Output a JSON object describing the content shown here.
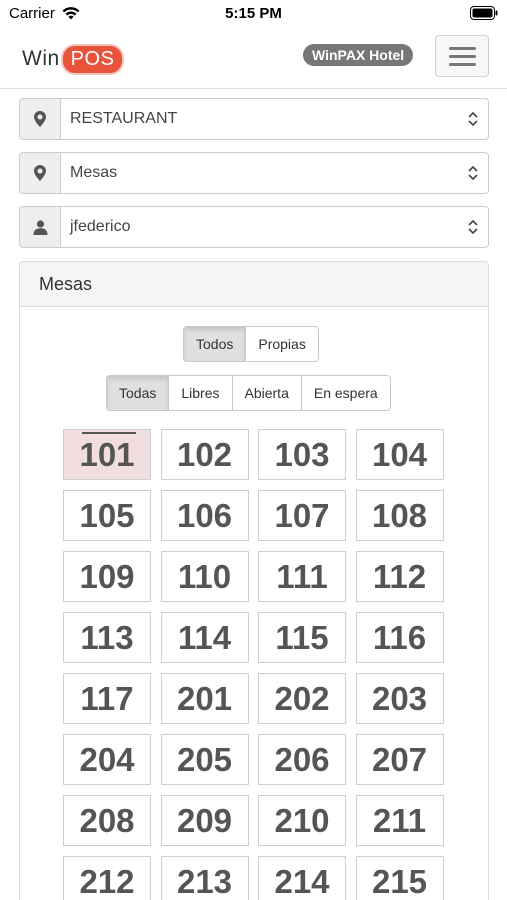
{
  "status_bar": {
    "carrier": "Carrier",
    "time": "5:15 PM"
  },
  "header": {
    "logo_win": "Win",
    "logo_pos": "POS",
    "hotel": "WinPAX Hotel"
  },
  "selects": {
    "location": "RESTAURANT",
    "area": "Mesas",
    "user": "jfederico"
  },
  "panel": {
    "title": "Mesas",
    "owner_filter": [
      "Todos",
      "Propias"
    ],
    "owner_active": "Todos",
    "status_filter": [
      "Todas",
      "Libres",
      "Abierta",
      "En espera"
    ],
    "status_active": "Todas",
    "tables": [
      {
        "label": "101",
        "state": "occupied"
      },
      {
        "label": "102",
        "state": "free"
      },
      {
        "label": "103",
        "state": "free"
      },
      {
        "label": "104",
        "state": "free"
      },
      {
        "label": "105",
        "state": "free"
      },
      {
        "label": "106",
        "state": "free"
      },
      {
        "label": "107",
        "state": "free"
      },
      {
        "label": "108",
        "state": "free"
      },
      {
        "label": "109",
        "state": "free"
      },
      {
        "label": "110",
        "state": "free"
      },
      {
        "label": "111",
        "state": "free"
      },
      {
        "label": "112",
        "state": "free"
      },
      {
        "label": "113",
        "state": "free"
      },
      {
        "label": "114",
        "state": "free"
      },
      {
        "label": "115",
        "state": "free"
      },
      {
        "label": "116",
        "state": "free"
      },
      {
        "label": "117",
        "state": "free"
      },
      {
        "label": "201",
        "state": "free"
      },
      {
        "label": "202",
        "state": "free"
      },
      {
        "label": "203",
        "state": "free"
      },
      {
        "label": "204",
        "state": "free"
      },
      {
        "label": "205",
        "state": "free"
      },
      {
        "label": "206",
        "state": "free"
      },
      {
        "label": "207",
        "state": "free"
      },
      {
        "label": "208",
        "state": "free"
      },
      {
        "label": "209",
        "state": "free"
      },
      {
        "label": "210",
        "state": "free"
      },
      {
        "label": "211",
        "state": "free"
      },
      {
        "label": "212",
        "state": "free"
      },
      {
        "label": "213",
        "state": "free"
      },
      {
        "label": "214",
        "state": "free"
      },
      {
        "label": "215",
        "state": "free"
      }
    ]
  },
  "colors": {
    "brand_accent": "#e8533c",
    "occupied_tile": "#f2dede",
    "badge": "#777777"
  },
  "icons": {
    "location": "map-marker-icon",
    "area": "map-marker-icon",
    "user": "user-icon",
    "menu": "hamburger-menu-icon"
  }
}
